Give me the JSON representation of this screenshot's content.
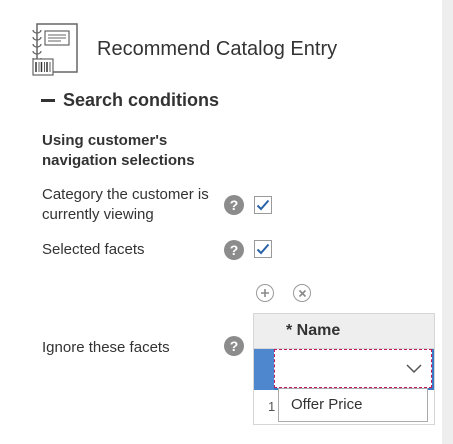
{
  "page": {
    "title": "Recommend Catalog Entry"
  },
  "search_conditions": {
    "title": "Search conditions",
    "subsection_title": "Using customer's navigation selections",
    "rows": [
      {
        "label": "Category the customer is currently viewing",
        "checked": true
      },
      {
        "label": "Selected facets",
        "checked": true
      },
      {
        "label": "Ignore these facets"
      }
    ],
    "help_glyph": "?"
  },
  "facets_grid": {
    "columns": [
      {
        "label": "* Name"
      }
    ],
    "row_numbers": [
      "1"
    ],
    "dropdown": {
      "value": "",
      "options": [
        "Offer Price"
      ]
    }
  },
  "icons": {
    "header": "catalog-entry-icon",
    "collapse": "minus-icon",
    "help": "help-icon",
    "add": "plus-circle-icon",
    "remove": "x-circle-icon",
    "dropdown": "chevron-down-icon"
  },
  "colors": {
    "checkmark": "#2a62a8",
    "selected_row": "#3a78c6",
    "editor_border": "#c2185b",
    "help_icon": "#8c8c8c"
  }
}
